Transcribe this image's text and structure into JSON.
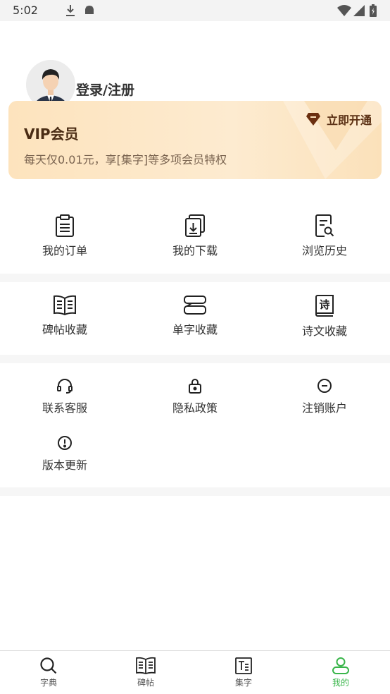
{
  "status_bar": {
    "time": "5:02"
  },
  "profile": {
    "login_label": "登录/注册"
  },
  "vip": {
    "title": "VIP会员",
    "description": "每天仅0.01元，享[集字]等多项会员特权",
    "open_label": "立即开通"
  },
  "menu1": [
    {
      "label": "我的订单",
      "icon": "clipboard-icon"
    },
    {
      "label": "我的下载",
      "icon": "download-icon"
    },
    {
      "label": "浏览历史",
      "icon": "history-icon"
    }
  ],
  "menu2": [
    {
      "label": "碑帖收藏",
      "icon": "book-open-icon"
    },
    {
      "label": "单字收藏",
      "icon": "stack-icon"
    },
    {
      "label": "诗文收藏",
      "icon": "poem-book-icon",
      "glyph": "诗"
    }
  ],
  "menu3": [
    {
      "label": "联系客服",
      "icon": "headset-icon"
    },
    {
      "label": "隐私政策",
      "icon": "lock-icon"
    },
    {
      "label": "注销账户",
      "icon": "minus-circle-icon"
    },
    {
      "label": "版本更新",
      "icon": "alert-circle-icon"
    }
  ],
  "tabs": [
    {
      "label": "字典",
      "icon": "search-icon",
      "active": false
    },
    {
      "label": "碑帖",
      "icon": "book-icon",
      "active": false
    },
    {
      "label": "集字",
      "icon": "text-icon",
      "active": false
    },
    {
      "label": "我的",
      "icon": "user-icon",
      "active": true
    }
  ],
  "colors": {
    "accent": "#39b54a",
    "vip_text": "#4a2c14",
    "vip_bg": "#fde6c4"
  }
}
